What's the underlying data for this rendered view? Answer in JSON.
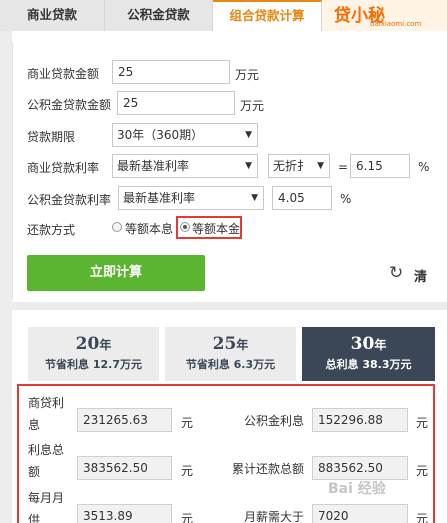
{
  "tabs": [
    {
      "label": "商业贷款"
    },
    {
      "label": "公积金贷款"
    },
    {
      "label": "组合贷款计算"
    }
  ],
  "logo": {
    "text": "贷小秘",
    "sub": "daixiaomi.com"
  },
  "form": {
    "commercial_amount": {
      "label": "商业贷款金额",
      "value": "25",
      "unit": "万元"
    },
    "fund_amount": {
      "label": "公积金贷款金额",
      "value": "25",
      "unit": "万元"
    },
    "term": {
      "label": "贷款期限",
      "selected": "30年（360期）"
    },
    "commercial_rate": {
      "label": "商业贷款利率",
      "rate_type": "最新基准利率",
      "discount": "无折扌",
      "equals": "=",
      "value": "6.15",
      "unit": "%"
    },
    "fund_rate": {
      "label": "公积金贷款利率",
      "rate_type": "最新基准利率",
      "value": "4.05",
      "unit": "%"
    },
    "repay": {
      "label": "还款方式",
      "option1": "等额本息",
      "option2": "等额本金",
      "selected": "等额本金"
    }
  },
  "actions": {
    "calc": "立即计算",
    "reset": "清"
  },
  "terms": [
    {
      "years": "20",
      "unit": "年",
      "sub": "节省利息 12.7万元",
      "selected": false
    },
    {
      "years": "25",
      "unit": "年",
      "sub": "节省利息 6.3万元",
      "selected": false
    },
    {
      "years": "30",
      "unit": "年",
      "sub": "总利息 38.3万元",
      "selected": true
    }
  ],
  "results": {
    "commercial_interest": {
      "label_line1": "商贷利",
      "label_line2": "息",
      "value": "231265.63",
      "unit": "元"
    },
    "fund_interest": {
      "label": "公积金利息",
      "value": "152296.88",
      "unit": "元"
    },
    "total_interest": {
      "label_line1": "利息总",
      "label_line2": "额",
      "value": "383562.50",
      "unit": "元"
    },
    "total_repay": {
      "label": "累计还款总额",
      "value": "883562.50",
      "unit": "元"
    },
    "monthly": {
      "label_line1": "每月月",
      "label_line2": "供",
      "value": "3513.89",
      "unit": "元"
    },
    "salary": {
      "label": "月薪需大于",
      "value": "7020",
      "unit": "元"
    }
  },
  "watermark": "Bai 经验"
}
